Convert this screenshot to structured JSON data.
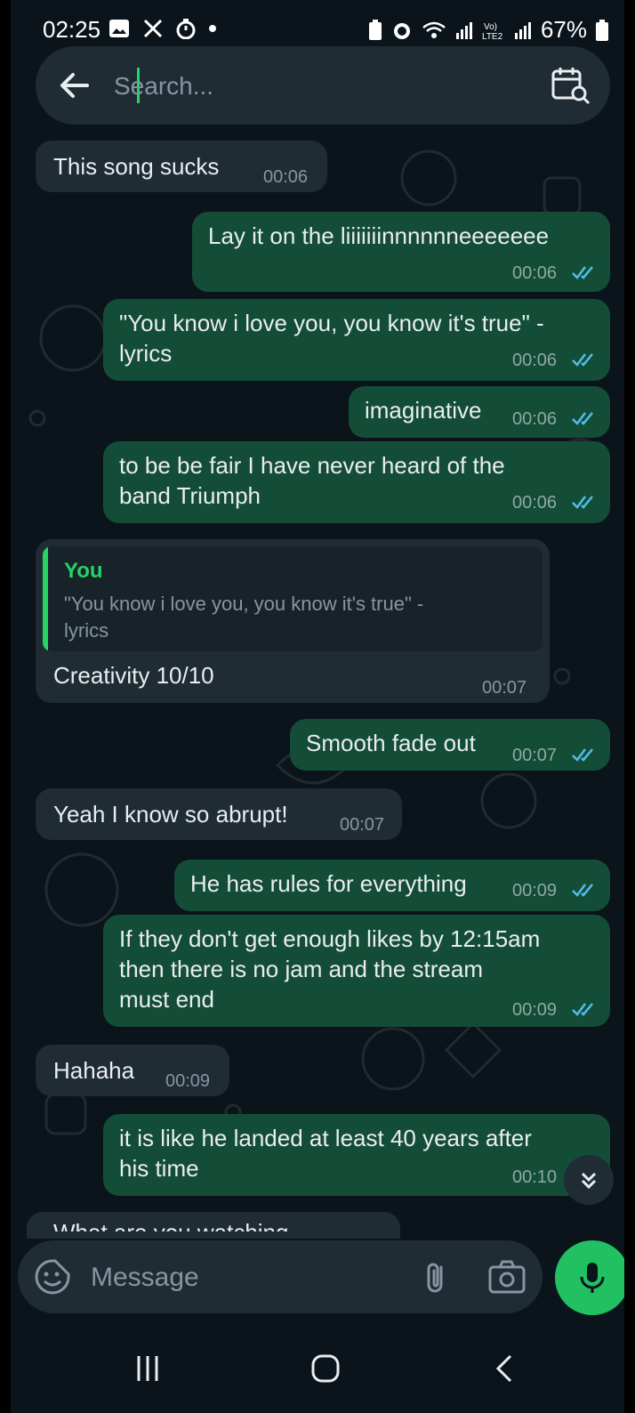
{
  "status_bar": {
    "time": "02:25",
    "battery_percent": "67%",
    "icons_left": [
      "gallery-icon",
      "x-icon",
      "timer-icon",
      "dot-icon"
    ],
    "icons_right": [
      "battery-saver-icon",
      "alarm-icon",
      "wifi-icon",
      "signal-icon",
      "volte-icon",
      "signal-icon",
      "battery-icon"
    ]
  },
  "search": {
    "placeholder": "Search..."
  },
  "messages": [
    {
      "direction": "incoming",
      "text": "This song sucks",
      "time": "00:06"
    },
    {
      "direction": "outgoing",
      "text": "Lay it on the liiiiiiinnnnnneeeeeee",
      "time": "00:06",
      "read": true
    },
    {
      "direction": "outgoing",
      "text": "\"You know i love you, you know it's true\" -\nlyrics",
      "time": "00:06",
      "read": true
    },
    {
      "direction": "outgoing",
      "text": "imaginative",
      "time": "00:06",
      "read": true
    },
    {
      "direction": "outgoing",
      "text": "to be be fair I have never heard of the\nband Triumph",
      "time": "00:06",
      "read": true
    },
    {
      "direction": "incoming",
      "quote_author": "You",
      "quote_text": "\"You know i love you, you know it's true\" -\nlyrics",
      "text": "Creativity 10/10",
      "time": "00:07"
    },
    {
      "direction": "outgoing",
      "text": "Smooth fade out",
      "time": "00:07",
      "read": true
    },
    {
      "direction": "incoming",
      "text": "Yeah I know so abrupt!",
      "time": "00:07"
    },
    {
      "direction": "outgoing",
      "text": "He has rules for everything",
      "time": "00:09",
      "read": true
    },
    {
      "direction": "outgoing",
      "text": "If they don't get enough likes by 12:15am\nthen there is no jam and the stream\nmust end",
      "time": "00:09",
      "read": true
    },
    {
      "direction": "incoming",
      "text": "Hahaha",
      "time": "00:09"
    },
    {
      "direction": "outgoing",
      "text": "it is like he landed at least 40 years after\nhis time",
      "time": "00:10",
      "read": true
    },
    {
      "direction": "incoming",
      "text": "What are you watching",
      "time": ""
    }
  ],
  "composer": {
    "placeholder": "Message"
  },
  "colors": {
    "background": "#0b141a",
    "incoming_bubble": "#1f2c34",
    "outgoing_bubble": "#144d37",
    "accent": "#25d366",
    "read_tick": "#53bdeb"
  }
}
